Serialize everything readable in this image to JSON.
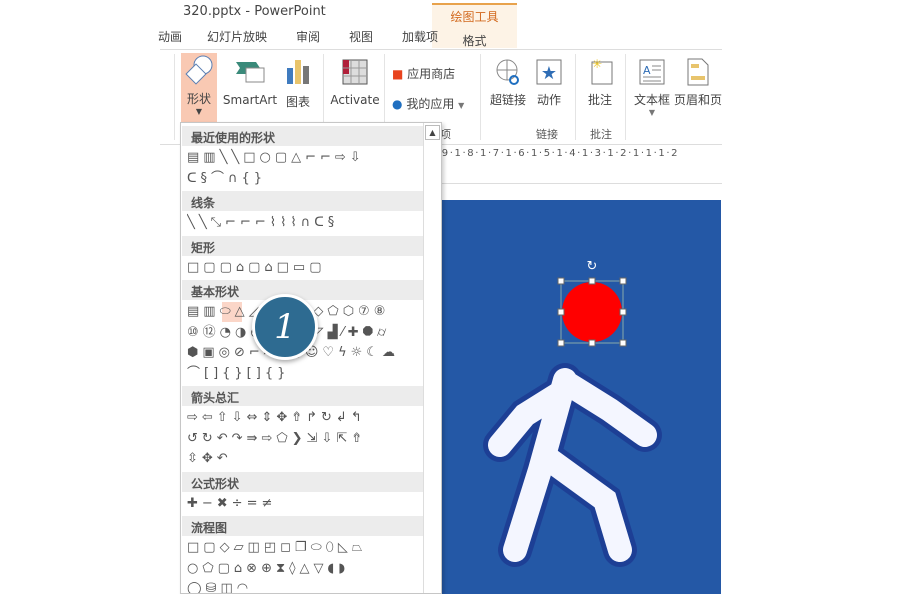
{
  "window": {
    "title": "320.pptx - PowerPoint"
  },
  "context_tab": {
    "group": "绘图工具",
    "tab": "格式"
  },
  "tabs": [
    "动画",
    "幻灯片放映",
    "审阅",
    "视图",
    "加载项"
  ],
  "ribbon": {
    "shapes": "形状",
    "smartart": "SmartArt",
    "chart": "图表",
    "activate": "Activate",
    "store": "应用商店",
    "myapps": "我的应用",
    "hyperlink": "超链接",
    "action": "动作",
    "comment": "批注",
    "textbox": "文本框",
    "header_footer": "页眉和页",
    "groups": {
      "apps": "项",
      "links": "链接",
      "comments": "批注"
    }
  },
  "ruler": "·9·1·8·1·7·1·6·1·5·1·4·1·3·1·2·1·1·1·2",
  "colors": {
    "accent": "#d2691e",
    "shape_selected": "#fbd6c8",
    "slide_bg": "#2458a6",
    "circle": "#ff0000",
    "badge": "#2e6b91"
  },
  "shapes_panel": {
    "sections": [
      {
        "title": "最近使用的形状",
        "rows": [
          "▤▥╲╲□○▢△⌐⌐⇨⇩",
          "ᑕ§⌒∩{}"
        ]
      },
      {
        "title": "线条",
        "rows": [
          "╲╲⤡⌐⌐⌐⌇⌇⌇∩ᑕ§"
        ]
      },
      {
        "title": "矩形",
        "rows": [
          "□▢▢⌂▢⌂□▭▢"
        ]
      },
      {
        "title": "基本形状",
        "rows": [
          "▤▥⬭△◿▱⌂⌂⌂◇⬠⬡⑦⑧",
          "⑩⑫◔◑◓◒◧⬚◸▟⁄✚⯃⌭",
          "⬢▣◎⊘⌐⌑⊓▢☺♡ϟ☼☾☁",
          "⌒[]{}[]{}"
        ]
      },
      {
        "title": "箭头总汇",
        "rows": [
          "⇨⇦⇧⇩⇔⇕✥⇮↱↻↲↰",
          "↺↻↶↷⇛⇨⬠❯⇲⇩⇱⇮",
          "⇳✥↶"
        ]
      },
      {
        "title": "公式形状",
        "rows": [
          "✚−✖÷=≠"
        ]
      },
      {
        "title": "流程图",
        "rows": [
          "□▢◇▱◫◰◻❐⬭⬯◺⏢",
          "○⬠▢⌂⊗⊕⧗◊△▽◖◗",
          "◯⛁◫◠"
        ]
      }
    ],
    "selected_shape": "oval"
  },
  "callout": {
    "number": "1"
  }
}
